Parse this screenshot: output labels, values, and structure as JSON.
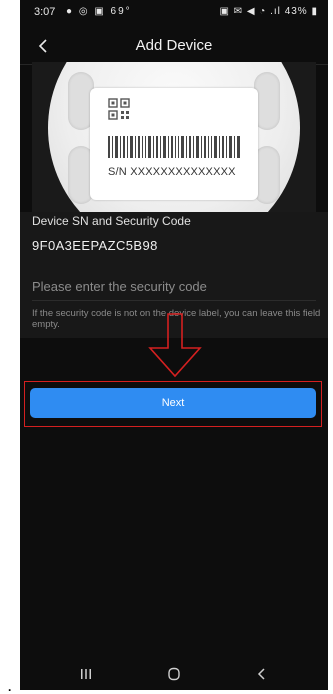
{
  "status_bar": {
    "time": "3:07",
    "left_icons": "● ◎ ▣ 69°",
    "right_icons": "▣ ✉ ◀ ◔ .ıl",
    "battery": "43%"
  },
  "header": {
    "title": "Add Device",
    "back_icon": "chevron-left-icon"
  },
  "device_image": {
    "label_sn": "S/N  XXXXXXXXXXXXXX"
  },
  "form": {
    "sn_label": "Device SN and Security Code",
    "sn_value": "9F0A3EEPAZC5B98",
    "security_placeholder": "Please enter the security code",
    "security_value": "",
    "hint": "If the security code is not on the device label, you can leave this field empty."
  },
  "actions": {
    "next_label": "Next"
  },
  "annotation": {
    "arrow_color": "#d42020",
    "highlight_color": "#d42020"
  },
  "nav": {
    "recents_icon": "recents-icon",
    "home_icon": "home-icon",
    "back_icon": "back-icon"
  },
  "colors": {
    "background": "#0d0d0d",
    "accent": "#2f8cf2"
  }
}
